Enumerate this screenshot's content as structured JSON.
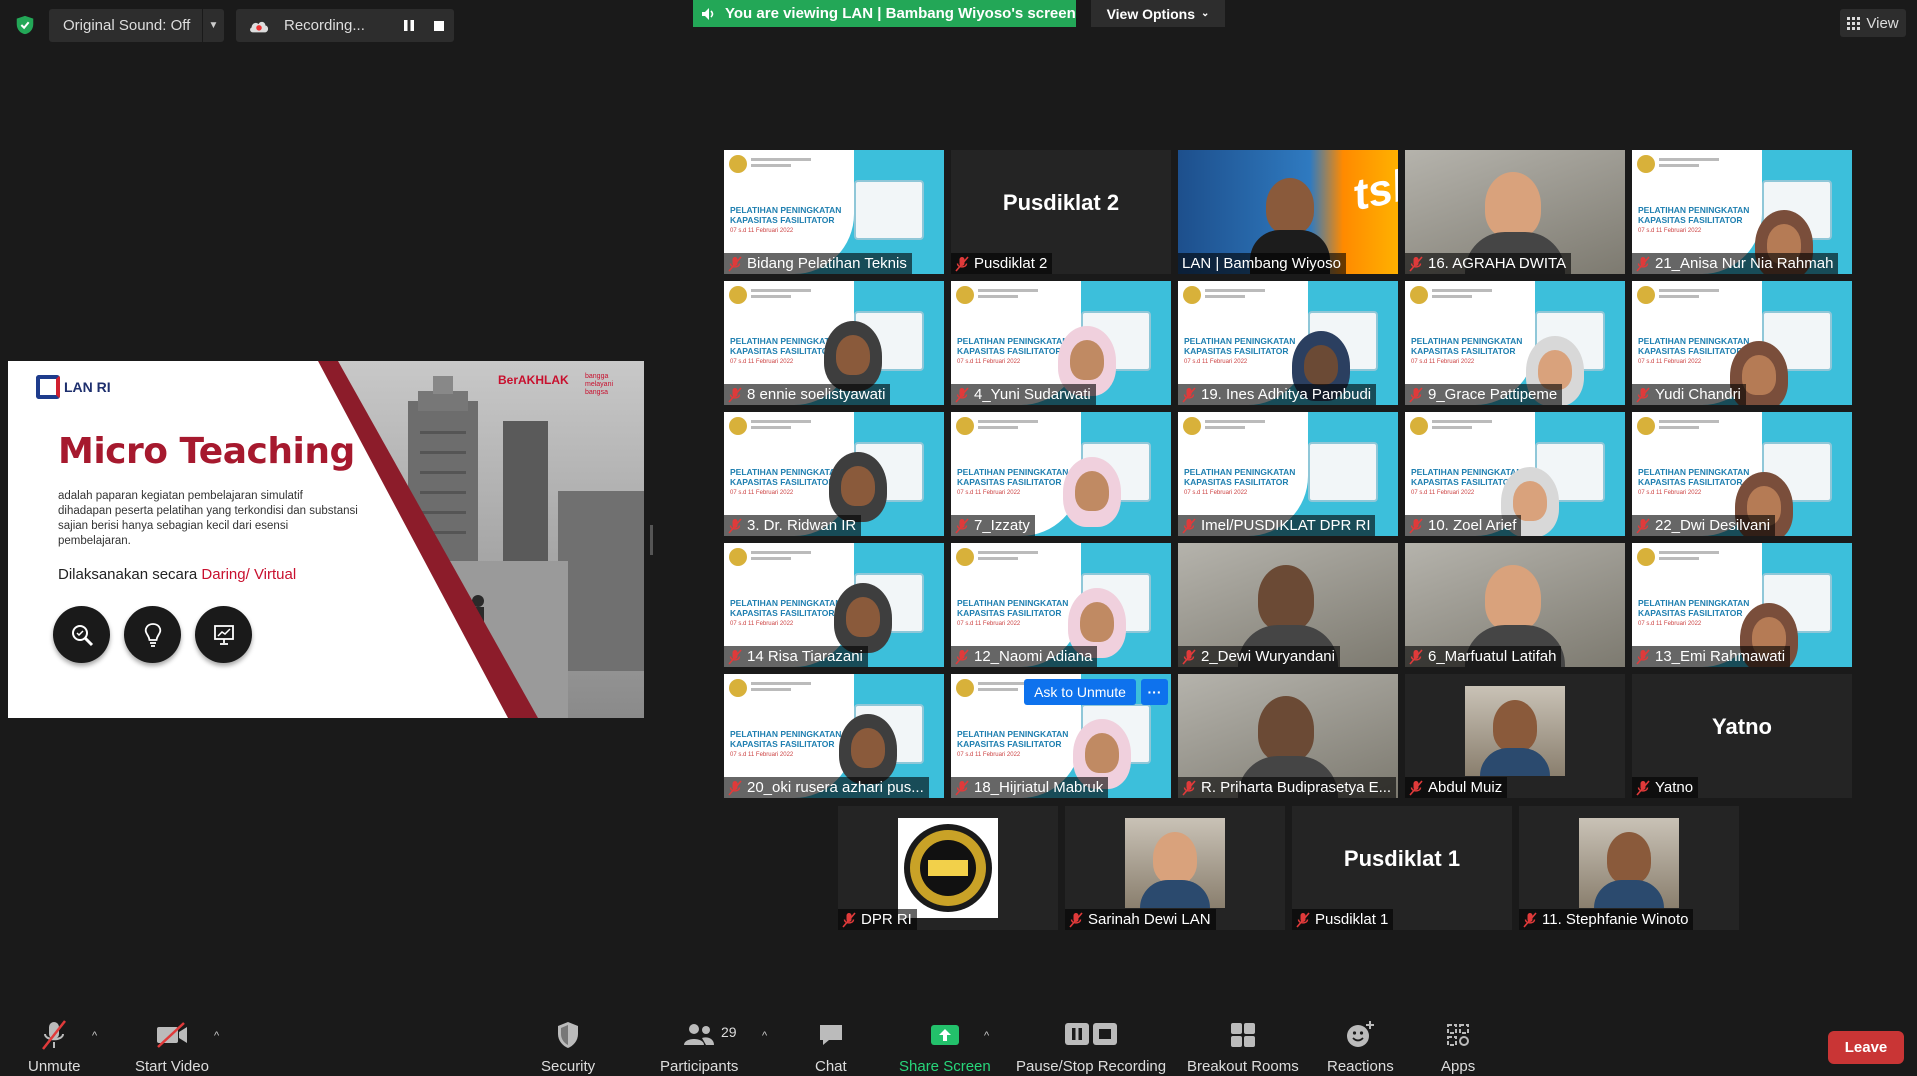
{
  "topbar": {
    "original_sound": "Original Sound: Off",
    "recording": "Recording...",
    "viewing_banner": "You are viewing LAN | Bambang Wiyoso's screen",
    "view_options": "View Options",
    "view": "View"
  },
  "slide": {
    "logo": "LAN RI",
    "title": "Micro Teaching",
    "description": "adalah paparan kegiatan pembelajaran simulatif dihadapan peserta pelatihan yang terkondisi dan substansi sajian berisi hanya sebagian kecil dari esensi pembelajaran.",
    "dilaksanakan": "Dilaksanakan secara ",
    "mode": "Daring/ Virtual",
    "berakhlak": "BerAKHLAK",
    "bangga": "bangga melayani bangsa"
  },
  "banner": {
    "title_line1": "PELATIHAN PENINGKATAN",
    "title_line2": "KAPASITAS FASILITATOR",
    "date": "07 s.d 11 Februari 2022"
  },
  "tiles": [
    {
      "name": "Bidang Pelatihan Teknis"
    },
    {
      "name": "Pusdiklat 2",
      "big": "Pusdiklat 2"
    },
    {
      "name": "LAN | Bambang Wiyoso"
    },
    {
      "name": "16. AGRAHA DWITA"
    },
    {
      "name": "21_Anisa Nur Nia Rahmah"
    },
    {
      "name": "8 ennie soelistyawati"
    },
    {
      "name": "4_Yuni Sudarwati"
    },
    {
      "name": "19. Ines Adhitya Pambudi"
    },
    {
      "name": "9_Grace Pattipeme"
    },
    {
      "name": "Yudi Chandri"
    },
    {
      "name": "3. Dr. Ridwan IR"
    },
    {
      "name": "7_Izzaty"
    },
    {
      "name": "Imel/PUSDIKLAT DPR RI"
    },
    {
      "name": "10. Zoel Arief"
    },
    {
      "name": "22_Dwi Desilvani"
    },
    {
      "name": "14 Risa Tiarazani"
    },
    {
      "name": "12_Naomi Adiana"
    },
    {
      "name": "2_Dewi Wuryandani"
    },
    {
      "name": "6_Marfuatul Latifah"
    },
    {
      "name": "13_Emi Rahmawati"
    },
    {
      "name": "20_oki rusera azhari pus..."
    },
    {
      "name": "18_Hijriatul Mabruk"
    },
    {
      "name": "R. Priharta Budiprasetya E..."
    },
    {
      "name": "Abdul Muiz"
    },
    {
      "name": "Yatno",
      "big": "Yatno"
    },
    {
      "name": "DPR RI"
    },
    {
      "name": "Sarinah Dewi LAN"
    },
    {
      "name": "Pusdiklat 1",
      "big": "Pusdiklat 1"
    },
    {
      "name": "11. Stephfanie Winoto"
    }
  ],
  "overlay": {
    "ask_to_unmute": "Ask to Unmute",
    "more": "···"
  },
  "toolbar": {
    "unmute": "Unmute",
    "start_video": "Start Video",
    "security": "Security",
    "participants": "Participants",
    "participants_count": "29",
    "chat": "Chat",
    "share_screen": "Share Screen",
    "pause_stop_recording": "Pause/Stop Recording",
    "breakout_rooms": "Breakout Rooms",
    "reactions": "Reactions",
    "apps": "Apps",
    "leave": "Leave"
  },
  "colors": {
    "accent_green": "#23a757",
    "active_speaker": "#f4c524",
    "leave_red": "#c93535",
    "ask_blue": "#0e72ed"
  }
}
